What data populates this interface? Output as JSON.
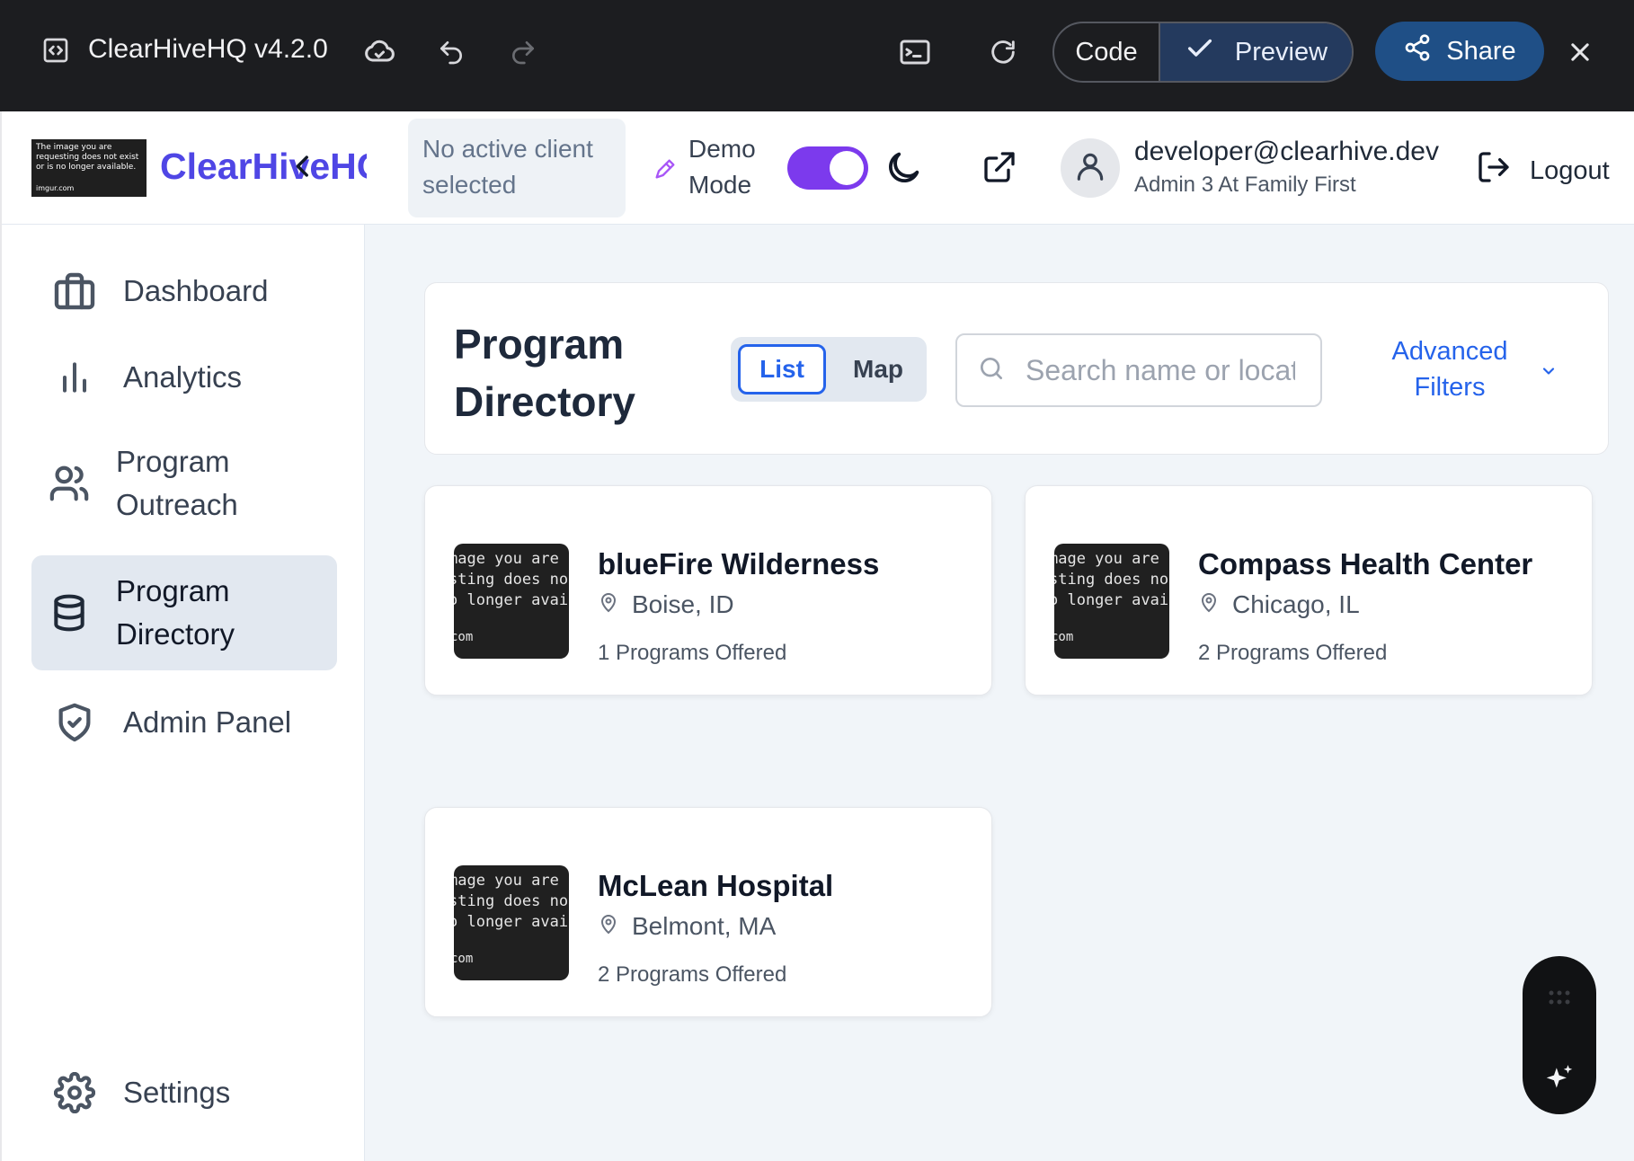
{
  "window": {
    "title": "ClearHiveHQ v4.2.0",
    "code_label": "Code",
    "preview_label": "Preview",
    "share_label": "Share"
  },
  "header": {
    "logo_alt_lines": [
      "The image you are",
      "requesting does not exist",
      "or is no longer available."
    ],
    "logo_foot": "imgur.com",
    "brand": "ClearHiveHQ",
    "client_status": "No active client selected",
    "demo_mode_label": "Demo Mode",
    "demo_mode_on": true,
    "user_email": "developer@clearhive.dev",
    "user_role": "Admin 3 At Family First",
    "logout_label": "Logout"
  },
  "sidebar": {
    "items": [
      {
        "label": "Dashboard",
        "icon": "briefcase-icon"
      },
      {
        "label": "Analytics",
        "icon": "bar-chart-icon"
      },
      {
        "label": "Program Outreach",
        "icon": "users-icon"
      },
      {
        "label": "Program Directory",
        "icon": "database-icon",
        "active": true
      },
      {
        "label": "Admin Panel",
        "icon": "shield-check-icon"
      }
    ],
    "settings_label": "Settings"
  },
  "directory": {
    "title": "Program Directory",
    "view_list": "List",
    "view_map": "Map",
    "active_view": "List",
    "search_placeholder": "Search name or location",
    "advanced_filters": "Advanced Filters"
  },
  "thumb_text": {
    "line1": "mage you are",
    "line2": "sting does not",
    "line3": "o longer avail",
    "line4": "com"
  },
  "programs": [
    {
      "name": "blueFire Wilderness",
      "location": "Boise, ID",
      "count": "1 Programs Offered"
    },
    {
      "name": "Compass Health Center",
      "location": "Chicago, IL",
      "count": "2 Programs Offered"
    },
    {
      "name": "McLean Hospital",
      "location": "Belmont, MA",
      "count": "2 Programs Offered"
    }
  ],
  "colors": {
    "brand": "#4f46e5",
    "accent": "#2563eb",
    "toggle": "#7c3aed",
    "share": "#1f4f86"
  }
}
